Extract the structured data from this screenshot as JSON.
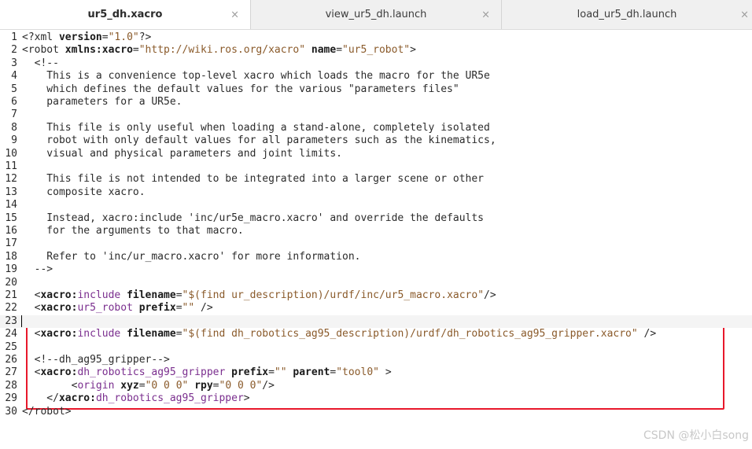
{
  "tabs": [
    {
      "label": "ur5_dh.xacro",
      "active": true
    },
    {
      "label": "view_ur5_dh.launch",
      "active": false
    },
    {
      "label": "load_ur5_dh.launch",
      "active": false
    }
  ],
  "close_glyph": "×",
  "current_line": 23,
  "lines": [
    {
      "n": "1",
      "tokens": [
        [
          "punc",
          "<?"
        ],
        [
          "tag",
          "xml "
        ],
        [
          "attr",
          "version"
        ],
        [
          "punc",
          "="
        ],
        [
          "str",
          "\"1.0\""
        ],
        [
          "punc",
          "?>"
        ]
      ]
    },
    {
      "n": "2",
      "tokens": [
        [
          "punc",
          "<"
        ],
        [
          "tag",
          "robot "
        ],
        [
          "attr",
          "xmlns:xacro"
        ],
        [
          "punc",
          "="
        ],
        [
          "str",
          "\"http://wiki.ros.org/xacro\""
        ],
        [
          "punc",
          " "
        ],
        [
          "attr",
          "name"
        ],
        [
          "punc",
          "="
        ],
        [
          "str",
          "\"ur5_robot\""
        ],
        [
          "punc",
          ">"
        ]
      ]
    },
    {
      "n": "3",
      "tokens": [
        [
          "comment",
          "  <!--"
        ]
      ]
    },
    {
      "n": "4",
      "tokens": [
        [
          "comment",
          "    This is a convenience top-level xacro which loads the macro for the UR5e"
        ]
      ]
    },
    {
      "n": "5",
      "tokens": [
        [
          "comment",
          "    which defines the default values for the various \"parameters files\""
        ]
      ]
    },
    {
      "n": "6",
      "tokens": [
        [
          "comment",
          "    parameters for a UR5e."
        ]
      ]
    },
    {
      "n": "7",
      "tokens": []
    },
    {
      "n": "8",
      "tokens": [
        [
          "comment",
          "    This file is only useful when loading a stand-alone, completely isolated"
        ]
      ]
    },
    {
      "n": "9",
      "tokens": [
        [
          "comment",
          "    robot with only default values for all parameters such as the kinematics,"
        ]
      ]
    },
    {
      "n": "10",
      "tokens": [
        [
          "comment",
          "    visual and physical parameters and joint limits."
        ]
      ]
    },
    {
      "n": "11",
      "tokens": []
    },
    {
      "n": "12",
      "tokens": [
        [
          "comment",
          "    This file is not intended to be integrated into a larger scene or other"
        ]
      ]
    },
    {
      "n": "13",
      "tokens": [
        [
          "comment",
          "    composite xacro."
        ]
      ]
    },
    {
      "n": "14",
      "tokens": []
    },
    {
      "n": "15",
      "tokens": [
        [
          "comment",
          "    Instead, xacro:include 'inc/ur5e_macro.xacro' and override the defaults"
        ]
      ]
    },
    {
      "n": "16",
      "tokens": [
        [
          "comment",
          "    for the arguments to that macro."
        ]
      ]
    },
    {
      "n": "17",
      "tokens": []
    },
    {
      "n": "18",
      "tokens": [
        [
          "comment",
          "    Refer to 'inc/ur_macro.xacro' for more information."
        ]
      ]
    },
    {
      "n": "19",
      "tokens": [
        [
          "comment",
          "  -->"
        ]
      ]
    },
    {
      "n": "20",
      "tokens": []
    },
    {
      "n": "21",
      "tokens": [
        [
          "punc",
          "  <"
        ],
        [
          "ns",
          "xacro:"
        ],
        [
          "name",
          "include "
        ],
        [
          "attr",
          "filename"
        ],
        [
          "punc",
          "="
        ],
        [
          "str",
          "\"$(find ur_description)/urdf/inc/ur5_macro.xacro\""
        ],
        [
          "punc",
          "/>"
        ]
      ]
    },
    {
      "n": "22",
      "tokens": [
        [
          "punc",
          "  <"
        ],
        [
          "ns",
          "xacro:"
        ],
        [
          "name",
          "ur5_robot "
        ],
        [
          "attr",
          "prefix"
        ],
        [
          "punc",
          "="
        ],
        [
          "str",
          "\"\""
        ],
        [
          "punc",
          " />"
        ]
      ]
    },
    {
      "n": "23",
      "tokens": []
    },
    {
      "n": "24",
      "tokens": [
        [
          "punc",
          "  <"
        ],
        [
          "ns",
          "xacro:"
        ],
        [
          "name",
          "include "
        ],
        [
          "attr",
          "filename"
        ],
        [
          "punc",
          "="
        ],
        [
          "str",
          "\"$(find dh_robotics_ag95_description)/urdf/dh_robotics_ag95_gripper.xacro\""
        ],
        [
          "punc",
          " />"
        ]
      ]
    },
    {
      "n": "25",
      "tokens": []
    },
    {
      "n": "26",
      "tokens": [
        [
          "comment",
          "  <!--dh_ag95_gripper-->"
        ]
      ]
    },
    {
      "n": "27",
      "tokens": [
        [
          "punc",
          "  <"
        ],
        [
          "ns",
          "xacro:"
        ],
        [
          "name",
          "dh_robotics_ag95_gripper "
        ],
        [
          "attr",
          "prefix"
        ],
        [
          "punc",
          "="
        ],
        [
          "str",
          "\"\""
        ],
        [
          "punc",
          " "
        ],
        [
          "attr",
          "parent"
        ],
        [
          "punc",
          "="
        ],
        [
          "str",
          "\"tool0\""
        ],
        [
          "punc",
          " >"
        ]
      ]
    },
    {
      "n": "28",
      "tokens": [
        [
          "punc",
          "        <"
        ],
        [
          "name",
          "origin "
        ],
        [
          "attr",
          "xyz"
        ],
        [
          "punc",
          "="
        ],
        [
          "str",
          "\"0 0 0\""
        ],
        [
          "punc",
          " "
        ],
        [
          "attr",
          "rpy"
        ],
        [
          "punc",
          "="
        ],
        [
          "str",
          "\"0 0 0\""
        ],
        [
          "punc",
          "/>"
        ]
      ]
    },
    {
      "n": "29",
      "tokens": [
        [
          "punc",
          "    </"
        ],
        [
          "ns",
          "xacro:"
        ],
        [
          "name",
          "dh_robotics_ag95_gripper"
        ],
        [
          "punc",
          ">"
        ]
      ]
    },
    {
      "n": "30",
      "tokens": [
        [
          "punc",
          "</"
        ],
        [
          "tag",
          "robot"
        ],
        [
          "punc",
          ">"
        ]
      ]
    }
  ],
  "watermark": "CSDN @松小白song",
  "colors": {
    "highlight_box": "#e8182b",
    "tag_name": "#7a2e8e",
    "string": "#8a5a2a"
  }
}
